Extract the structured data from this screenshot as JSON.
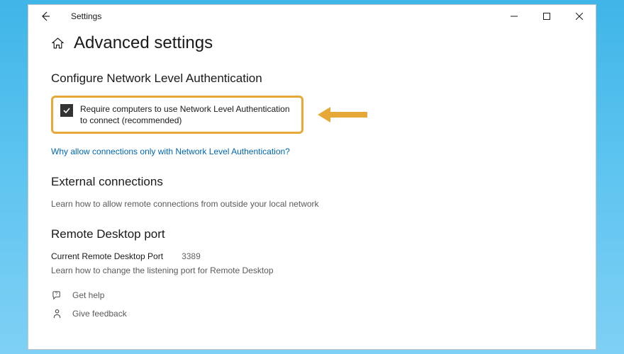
{
  "app": {
    "title": "Settings"
  },
  "page": {
    "title": "Advanced settings"
  },
  "sections": {
    "nla": {
      "heading": "Configure Network Level Authentication",
      "checkbox_label": "Require computers to use Network Level Authentication to connect (recommended)",
      "link": "Why allow connections only with Network Level Authentication?"
    },
    "external": {
      "heading": "External connections",
      "body": "Learn how to allow remote connections from outside your local network"
    },
    "port": {
      "heading": "Remote Desktop port",
      "label": "Current Remote Desktop Port",
      "value": "3389",
      "body": "Learn how to change the listening port for Remote Desktop"
    }
  },
  "footer": {
    "help": "Get help",
    "feedback": "Give feedback"
  }
}
